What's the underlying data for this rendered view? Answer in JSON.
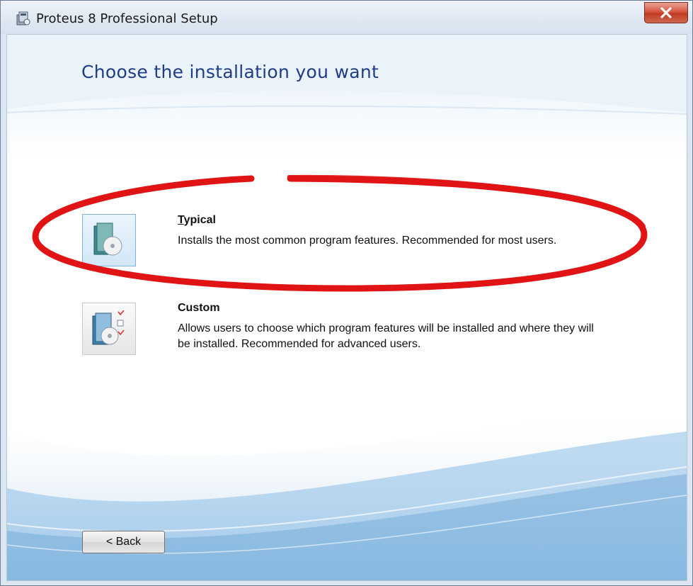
{
  "window": {
    "title": "Proteus 8 Professional Setup",
    "close_label": "x"
  },
  "page": {
    "heading": "Choose the installation you want"
  },
  "options": [
    {
      "title": "Typical",
      "description": "Installs the most common program features. Recommended for most users.",
      "selected": true,
      "icon": "install-disc-icon"
    },
    {
      "title": "Custom",
      "description": "Allows users to choose which program features will be installed and where they will be installed. Recommended for advanced users.",
      "selected": false,
      "icon": "install-checklist-icon"
    }
  ],
  "annotation": {
    "color": "#e01414",
    "target": "Typical"
  },
  "footer": {
    "back_label": "< Back"
  },
  "colors": {
    "heading": "#1f3c88",
    "annotation": "#e01414"
  }
}
